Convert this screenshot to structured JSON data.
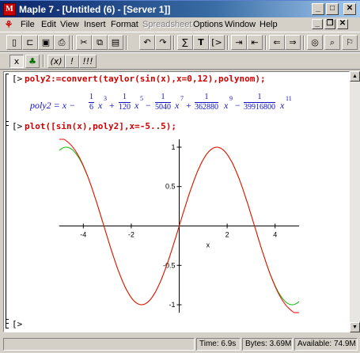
{
  "window": {
    "title": "Maple 7 - [Untitled (6) - [Server 1]]",
    "app_icon": "maple-leaf-icon",
    "buttons": [
      "minimize",
      "maximize",
      "close"
    ]
  },
  "menu": {
    "items": [
      "File",
      "Edit",
      "View",
      "Insert",
      "Format",
      "Spreadsheet",
      "Options",
      "Window",
      "Help"
    ],
    "disabled": [
      "Spreadsheet"
    ]
  },
  "toolbar": {
    "buttons": [
      {
        "name": "new-icon",
        "glyph": "🗋"
      },
      {
        "name": "open-icon",
        "glyph": "📂"
      },
      {
        "name": "save-icon",
        "glyph": "💾"
      },
      {
        "name": "print-icon",
        "glyph": "⎙"
      },
      {
        "name": "cut-icon",
        "glyph": "✂"
      },
      {
        "name": "copy-icon",
        "glyph": "⧉"
      },
      {
        "name": "paste-icon",
        "glyph": "📋"
      },
      {
        "name": "undo-icon",
        "glyph": "↶"
      },
      {
        "name": "redo-icon",
        "glyph": "↷"
      },
      {
        "name": "text-icon",
        "glyph": "∑"
      },
      {
        "name": "text-mode-icon",
        "glyph": "T"
      },
      {
        "name": "prompt-icon",
        "glyph": "[>"
      },
      {
        "name": "indent-icon",
        "glyph": "≣"
      },
      {
        "name": "outdent-icon",
        "glyph": "≡"
      },
      {
        "name": "back-icon",
        "glyph": "⇐"
      },
      {
        "name": "forward-icon",
        "glyph": "⇒"
      },
      {
        "name": "stop-icon",
        "glyph": "◎"
      },
      {
        "name": "zoom-icon",
        "glyph": "⌕"
      },
      {
        "name": "restart-icon",
        "glyph": "⚐"
      }
    ]
  },
  "toolbar2": {
    "buttons": [
      {
        "name": "maple-input-icon",
        "glyph": "x"
      },
      {
        "name": "maple-leaf-icon",
        "glyph": "♣"
      },
      {
        "name": "math-mode-icon",
        "glyph": "(x)"
      },
      {
        "name": "execute-icon",
        "glyph": "!"
      },
      {
        "name": "execute-all-icon",
        "glyph": "!!!"
      }
    ]
  },
  "worksheet": {
    "prompt": "[>",
    "input1": "poly2:=convert(taylor(sin(x),x=0,12),polynom);",
    "output_label": "poly2 = x −",
    "input2": "plot([sin(x),poly2],x=-5..5);",
    "empty_prompt": "[>"
  },
  "chart_data": {
    "type": "line",
    "xlim": [
      -5,
      5
    ],
    "ylim": [
      -1.1,
      1.1
    ],
    "xticks": [
      -4,
      -2,
      2,
      4
    ],
    "yticks": [
      -1,
      -0.5,
      0.5,
      1
    ],
    "xlabel": "x",
    "series": [
      {
        "color": "#00c000",
        "fn": "sin"
      },
      {
        "color": "#ff0000",
        "fn": "poly11"
      }
    ]
  },
  "status": {
    "time": "Time: 6.9s",
    "bytes": "Bytes: 3.69M",
    "available": "Available: 74.9M"
  }
}
